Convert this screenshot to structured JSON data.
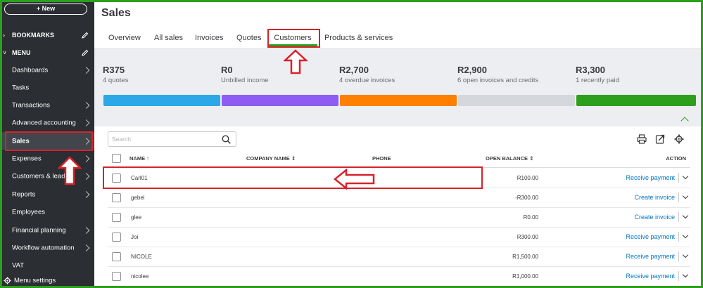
{
  "sidebar": {
    "new_label": "+ New",
    "bookmarks_label": "BOOKMARKS",
    "menu_label": "MENU",
    "items": [
      {
        "label": "Dashboards"
      },
      {
        "label": "Tasks"
      },
      {
        "label": "Transactions"
      },
      {
        "label": "Advanced accounting"
      },
      {
        "label": "Sales"
      },
      {
        "label": "Expenses"
      },
      {
        "label": "Customers & leads"
      },
      {
        "label": "Reports"
      },
      {
        "label": "Employees"
      },
      {
        "label": "Financial planning"
      },
      {
        "label": "Workflow automation"
      },
      {
        "label": "VAT"
      }
    ],
    "menu_settings_label": "Menu settings"
  },
  "page": {
    "title": "Sales"
  },
  "tabs": [
    "Overview",
    "All sales",
    "Invoices",
    "Quotes",
    "Customers",
    "Products & services"
  ],
  "summary": [
    {
      "amount": "R375",
      "label": "4 quotes",
      "color": "#2ca8e8"
    },
    {
      "amount": "R0",
      "label": "Unbilled income",
      "color": "#8e5cf2"
    },
    {
      "amount": "R2,700",
      "label": "4 overdue invoices",
      "color": "#ff8000"
    },
    {
      "amount": "R2,900",
      "label": "6 open invoices and credits",
      "color": "#d4d7dc"
    },
    {
      "amount": "R3,300",
      "label": "1 recently paid",
      "color": "#2ca01c"
    }
  ],
  "search": {
    "placeholder": "Search"
  },
  "table": {
    "headers": {
      "name": "NAME",
      "name_sort": "↑",
      "company": "COMPANY NAME",
      "company_sort": "⇕",
      "phone": "PHONE",
      "balance": "OPEN BALANCE",
      "balance_sort": "⇕",
      "action": "ACTION"
    },
    "rows": [
      {
        "name": "Carl01",
        "balance": "R100.00",
        "action": "Receive payment"
      },
      {
        "name": "gebel",
        "balance": "-R300.00",
        "action": "Create invoice"
      },
      {
        "name": "glee",
        "balance": "R0.00",
        "action": "Create invoice"
      },
      {
        "name": "Joi",
        "balance": "R300.00",
        "action": "Receive payment"
      },
      {
        "name": "NICOLE",
        "balance": "R1,500.00",
        "action": "Receive payment"
      },
      {
        "name": "nicolee",
        "balance": "R1,000.00",
        "action": "Receive payment"
      }
    ]
  },
  "colors": {
    "accent": "#2ca01c",
    "link": "#0077c5",
    "annotation": "#d6232a",
    "sidebar": "#2b2e33"
  }
}
